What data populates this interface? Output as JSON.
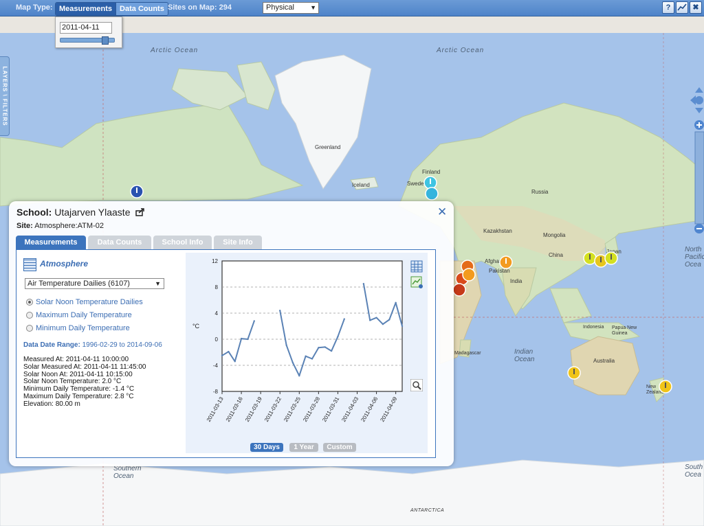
{
  "topbar": {
    "map_type_label": "Map Type:",
    "mode_measurements": "Measurements",
    "mode_data_counts": "Data Counts",
    "sites_label": "Sites on Map:",
    "sites_count": "294",
    "basemap_select": "Physical",
    "help_icon": "?",
    "chart_icon": "chart-icon",
    "close_icon": "✖"
  },
  "date_picker": {
    "value": "2011-04-11",
    "slider_fraction": 0.85
  },
  "layers_tab": "LAYERS \\ FILTERS",
  "map_labels": {
    "arctic1": "Arctic Ocean",
    "arctic2": "Arctic Ocean",
    "greenland": "Greenland",
    "iceland": "Iceland",
    "finland": "Finland",
    "sweden": "Sweden",
    "russia": "Russia",
    "kazakhstan": "Kazakhstan",
    "mongolia": "Mongolia",
    "china": "China",
    "japan": "Japan",
    "afghan": "Afghan",
    "pakistan": "Pakistan",
    "india": "India",
    "north_pacific": "North Pacific Ocea",
    "papua": "Papua New Guinea",
    "indonesia": "Indonesia",
    "indian_ocean": "Indian Ocean",
    "australia": "Australia",
    "new_zealand": "New Zealand",
    "madagascar": "Madagascar",
    "southern_ocean": "Southern Ocean",
    "south_right": "South Ocea",
    "antarctica": "ANTARCTICA"
  },
  "popup": {
    "school_label": "School:",
    "school_name": "Utajarven Ylaaste",
    "site_label": "Site:",
    "site_value": "Atmosphere:ATM-02",
    "tabs": [
      "Measurements",
      "Data Counts",
      "School Info",
      "Site Info"
    ],
    "protocol_title": "Atmosphere",
    "dataset_select": "Air Temperature Dailies (6107)",
    "radios": [
      {
        "label": "Solar Noon Temperature Dailies",
        "selected": true
      },
      {
        "label": "Maximum Daily Temperature",
        "selected": false
      },
      {
        "label": "Minimum Daily Temperature",
        "selected": false
      }
    ],
    "date_range_label": "Data Date Range:",
    "date_range_value": "1996-02-29 to 2014-09-06",
    "details": [
      "Measured At: 2011-04-11 10:00:00",
      "Solar Measured At: 2011-04-11 11:45:00",
      "Solar Noon At: 2011-04-11 10:15:00",
      "Solar Noon Temperature: 2.0 °C",
      "Minimum Daily Temperature: -1.4 °C",
      "Maximum Daily Temperature: 2.8 °C",
      "Elevation: 80.00 m"
    ],
    "range_buttons": [
      "30 Days",
      "1 Year",
      "Custom"
    ],
    "active_range": "30 Days"
  },
  "chart_data": {
    "type": "line",
    "ylabel": "°C",
    "ylim": [
      -8,
      12
    ],
    "yticks": [
      -8,
      -4,
      0,
      4,
      8,
      12
    ],
    "xticks": [
      "2011-03-13",
      "2011-03-16",
      "2011-03-19",
      "2011-03-22",
      "2011-03-25",
      "2011-03-28",
      "2011-03-31",
      "2011-04-03",
      "2011-04-06",
      "2011-04-09"
    ],
    "grid": true,
    "segments": [
      [
        [
          "2011-03-13",
          -2.5
        ],
        [
          "2011-03-14",
          -1.9
        ],
        [
          "2011-03-15",
          -3.4
        ],
        [
          "2011-03-16",
          0.1
        ],
        [
          "2011-03-17",
          0.0
        ],
        [
          "2011-03-18",
          2.8
        ]
      ],
      [
        [
          "2011-03-22",
          4.4
        ],
        [
          "2011-03-23",
          -0.9
        ],
        [
          "2011-03-24",
          -3.6
        ],
        [
          "2011-03-25",
          -5.6
        ],
        [
          "2011-03-26",
          -2.6
        ],
        [
          "2011-03-27",
          -3.0
        ],
        [
          "2011-03-28",
          -1.3
        ],
        [
          "2011-03-29",
          -1.2
        ],
        [
          "2011-03-30",
          -1.8
        ],
        [
          "2011-03-31",
          0.4
        ],
        [
          "2011-04-01",
          3.1
        ]
      ],
      [
        [
          "2011-04-04",
          8.5
        ],
        [
          "2011-04-05",
          2.9
        ],
        [
          "2011-04-06",
          3.3
        ],
        [
          "2011-04-07",
          2.3
        ],
        [
          "2011-04-08",
          3.0
        ],
        [
          "2011-04-09",
          5.6
        ],
        [
          "2011-04-10",
          2.0
        ]
      ]
    ],
    "line_color": "#5a82b5"
  }
}
